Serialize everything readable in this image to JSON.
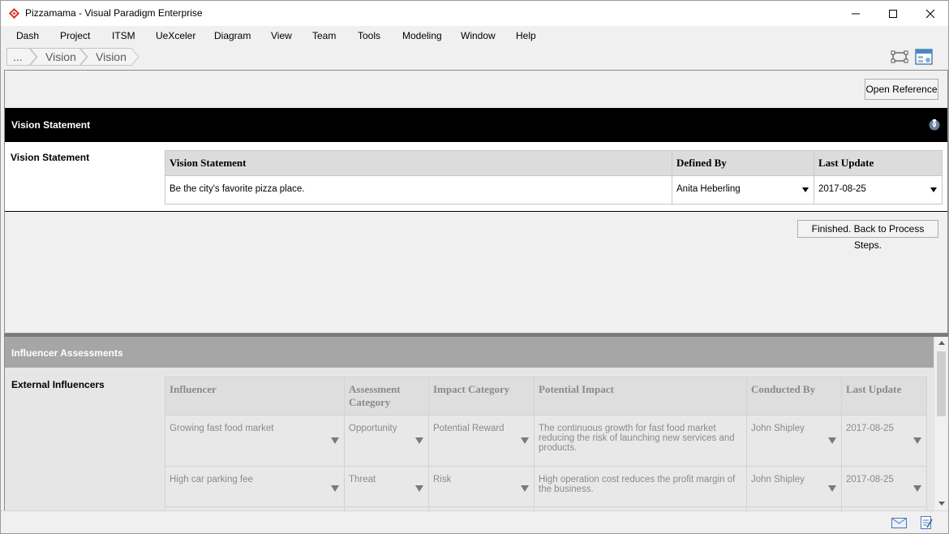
{
  "window": {
    "title": "Pizzamama - Visual Paradigm Enterprise"
  },
  "menu": [
    "Dash",
    "Project",
    "ITSM",
    "UeXceler",
    "Diagram",
    "View",
    "Team",
    "Tools",
    "Modeling",
    "Window",
    "Help"
  ],
  "breadcrumb": [
    "...",
    "Vision",
    "Vision"
  ],
  "top": {
    "open_reference": "Open Reference",
    "section_title": "Vision Statement",
    "row_label": "Vision Statement",
    "columns": [
      "Vision Statement",
      "Defined By",
      "Last Update"
    ],
    "row": {
      "statement": "Be the city's favorite pizza place.",
      "defined_by": "Anita Heberling",
      "last_update": "2017-08-25"
    },
    "finished_button": "Finished. Back to Process Steps."
  },
  "bottom": {
    "section_title": "Influencer Assessments",
    "row_label": "External Influencers",
    "columns": [
      "Influencer",
      "Assessment Category",
      "Impact Category",
      "Potential Impact",
      "Conducted By",
      "Last Update"
    ],
    "rows": [
      {
        "influencer": "Growing fast food market",
        "assessment": "Opportunity",
        "impact": "Potential Reward",
        "potential": "The continuous growth for fast food market reducing the risk of launching new services and products.",
        "conducted_by": "John Shipley",
        "last_update": "2017-08-25"
      },
      {
        "influencer": "High car parking fee",
        "assessment": "Threat",
        "impact": "Risk",
        "potential": "High operation cost reduces the profit margin of the business.",
        "conducted_by": "John Shipley",
        "last_update": "2017-08-25"
      }
    ]
  },
  "icons": [
    "app-logo-icon",
    "minimize-icon",
    "maximize-icon",
    "close-icon",
    "fit-diagram-icon",
    "panel-icon",
    "pin-icon",
    "mail-icon",
    "notes-icon"
  ]
}
